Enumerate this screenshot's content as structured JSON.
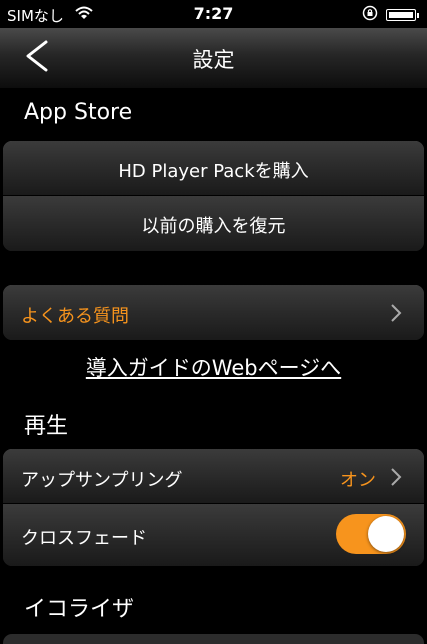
{
  "status": {
    "carrier": "SIMなし",
    "time": "7:27"
  },
  "nav": {
    "title": "設定"
  },
  "appstore": {
    "header": "App Store",
    "buy_label": "HD Player Packを購入",
    "restore_label": "以前の購入を復元"
  },
  "faq": {
    "label": "よくある質問"
  },
  "guide_link": "導入ガイドのWebページへ",
  "playback": {
    "header": "再生",
    "upsampling_label": "アップサンプリング",
    "upsampling_value": "オン",
    "crossfade_label": "クロスフェード",
    "crossfade_on": true
  },
  "equalizer": {
    "header": "イコライザ"
  },
  "colors": {
    "accent": "#f7941d"
  }
}
